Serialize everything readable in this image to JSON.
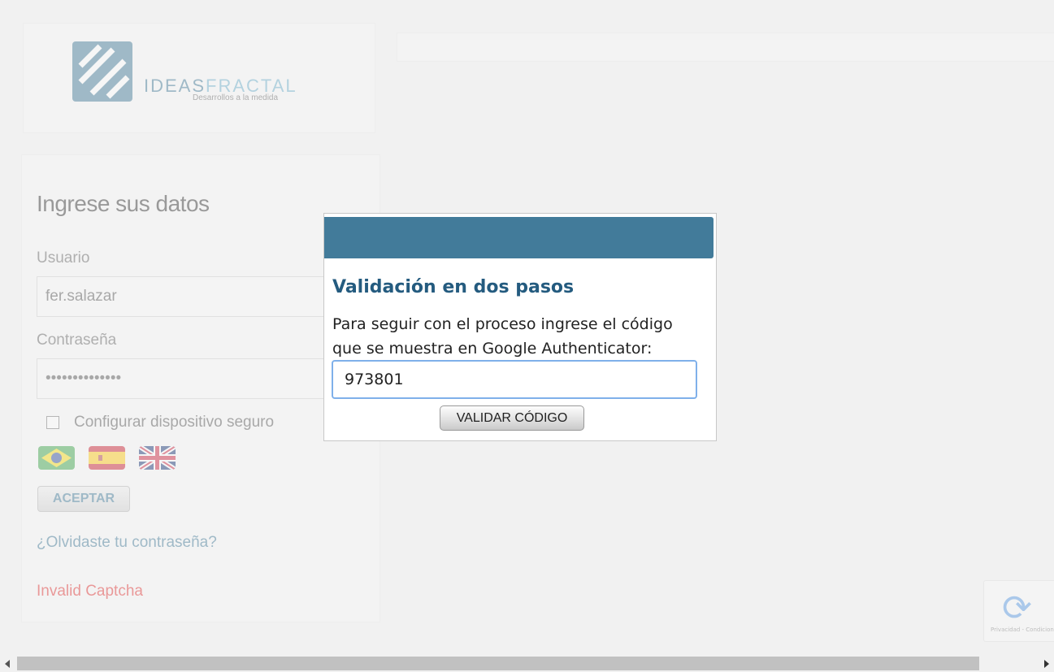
{
  "brand": {
    "name_dark": "IDEAS",
    "name_light": "FRACTAL",
    "tagline": "Desarrollos a la medida"
  },
  "login": {
    "title": "Ingrese sus datos",
    "user_label": "Usuario",
    "user_value": "fer.salazar",
    "password_label": "Contraseña",
    "password_value": "••••••••••••••",
    "secure_device_label": "Configurar dispositivo seguro",
    "accept_label": "ACEPTAR",
    "forgot_label": "¿Olvidaste tu contraseña?",
    "captcha_error": "Invalid Captcha",
    "languages": [
      "brazil-flag-icon",
      "spain-flag-icon",
      "uk-flag-icon"
    ]
  },
  "recaptcha": {
    "footer": "Privacidad - Condiciones"
  },
  "modal": {
    "title": "Validación en dos pasos",
    "instructions": "Para seguir con el proceso ingrese el código que se muestra en Google Authenticator:",
    "code_value": "973801",
    "validate_label": "VALIDAR CÓDIGO",
    "header_color": "#427b9a"
  }
}
